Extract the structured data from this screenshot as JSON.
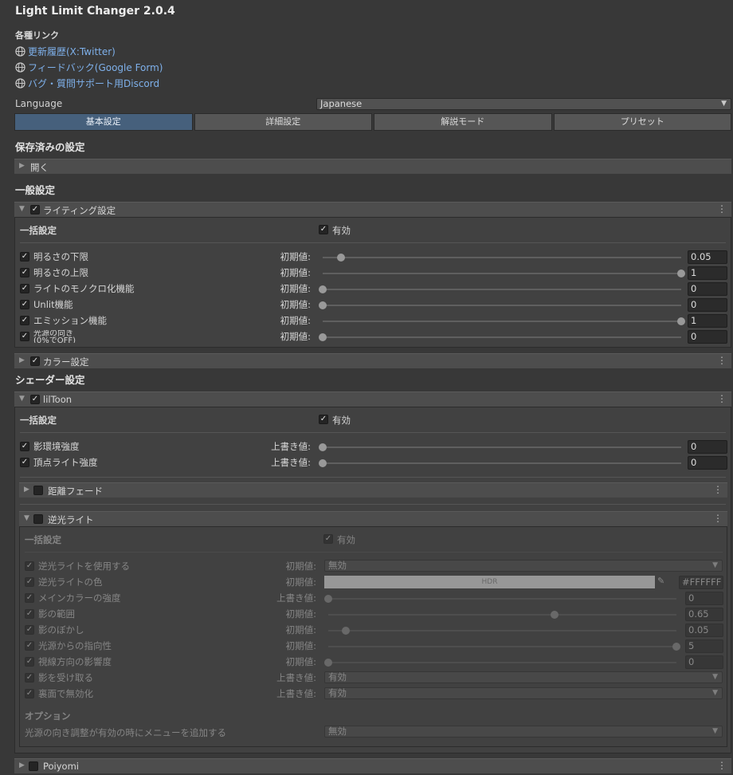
{
  "app": {
    "title": "Light Limit Changer 2.0.4"
  },
  "links": {
    "heading": "各種リンク",
    "items": [
      {
        "label": "更新履歴(X:Twitter)"
      },
      {
        "label": "フィードバック(Google Form)"
      },
      {
        "label": "バグ・質問サポート用Discord"
      }
    ]
  },
  "language": {
    "label": "Language",
    "value": "Japanese"
  },
  "tabs": [
    "基本設定",
    "詳細設定",
    "解説モード",
    "プリセット"
  ],
  "saved": {
    "heading": "保存済みの設定",
    "fold_label": "開く"
  },
  "general": {
    "heading": "一般設定",
    "lighting": {
      "label": "ライティング設定",
      "bulk_label": "一括設定",
      "enabled_label": "有効",
      "rows": [
        {
          "label": "明るさの下限",
          "field": "初期値:",
          "value": "0.05",
          "fraction": 0.05
        },
        {
          "label": "明るさの上限",
          "field": "初期値:",
          "value": "1",
          "fraction": 1
        },
        {
          "label": "ライトのモノクロ化機能",
          "field": "初期値:",
          "value": "0",
          "fraction": 0
        },
        {
          "label": "Unlit機能",
          "field": "初期値:",
          "value": "0",
          "fraction": 0
        },
        {
          "label": "エミッション機能",
          "field": "初期値:",
          "value": "1",
          "fraction": 1
        },
        {
          "label": "光源の向き\n(0%でOFF)",
          "field": "初期値:",
          "value": "0",
          "fraction": 0
        }
      ]
    },
    "color": {
      "label": "カラー設定"
    }
  },
  "shader": {
    "heading": "シェーダー設定",
    "liltoon": {
      "label": "lilToon",
      "bulk_label": "一括設定",
      "enabled_label": "有効",
      "rows": [
        {
          "label": "影環境強度",
          "field": "上書き値:",
          "value": "0",
          "fraction": 0
        },
        {
          "label": "頂点ライト強度",
          "field": "上書き値:",
          "value": "0",
          "fraction": 0
        }
      ],
      "distance_fade": {
        "label": "距離フェード"
      },
      "backlight": {
        "label": "逆光ライト",
        "bulk_label": "一括設定",
        "enabled_label": "有効",
        "rows": [
          {
            "label": "逆光ライトを使用する",
            "field": "初期値:",
            "kind": "dropdown",
            "value": "無効"
          },
          {
            "label": "逆光ライトの色",
            "field": "初期値:",
            "kind": "color",
            "value": "#FFFFFF",
            "hdr": "HDR"
          },
          {
            "label": "メインカラーの強度",
            "field": "上書き値:",
            "kind": "slider",
            "value": "0",
            "fraction": 0
          },
          {
            "label": "影の範囲",
            "field": "初期値:",
            "kind": "slider",
            "value": "0.65",
            "fraction": 0.65
          },
          {
            "label": "影のぼかし",
            "field": "初期値:",
            "kind": "slider",
            "value": "0.05",
            "fraction": 0.05
          },
          {
            "label": "光源からの指向性",
            "field": "初期値:",
            "kind": "slider",
            "value": "5",
            "fraction": 1
          },
          {
            "label": "視線方向の影響度",
            "field": "初期値:",
            "kind": "slider",
            "value": "0",
            "fraction": 0
          },
          {
            "label": "影を受け取る",
            "field": "上書き値:",
            "kind": "dropdown",
            "value": "有効"
          },
          {
            "label": "裏面で無効化",
            "field": "上書き値:",
            "kind": "dropdown",
            "value": "有効"
          }
        ],
        "options_heading": "オプション",
        "option_label": "光源の向き調整が有効の時にメニューを追加する",
        "option_value": "無効"
      }
    },
    "poiyomi": {
      "label": "Poiyomi"
    }
  },
  "colors": {
    "accent": "#46607c",
    "link": "#7eb0ea",
    "background": "#383838"
  }
}
